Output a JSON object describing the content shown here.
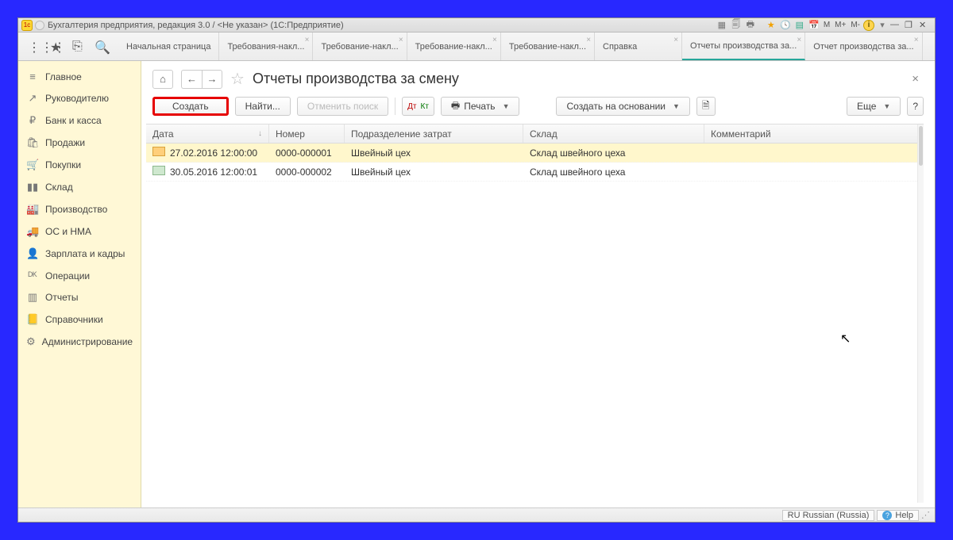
{
  "window": {
    "title": "Бухгалтерия предприятия, редакция 3.0 / <Не указан> (1С:Предприятие)"
  },
  "titlebar_btns": {
    "m": "M",
    "mplus": "M+",
    "mminus": "M-"
  },
  "tabs": {
    "start": "Начальная страница",
    "items": [
      {
        "label": "Требования-накл..."
      },
      {
        "label": "Требование-накл..."
      },
      {
        "label": "Требование-накл..."
      },
      {
        "label": "Требование-накл..."
      },
      {
        "label": "Справка"
      },
      {
        "label": "Отчеты производства за...",
        "active": true
      },
      {
        "label": "Отчет производства за..."
      }
    ]
  },
  "sidebar": [
    {
      "icon": "≡",
      "label": "Главное"
    },
    {
      "icon": "↗",
      "label": "Руководителю"
    },
    {
      "icon": "₽",
      "label": "Банк и касса"
    },
    {
      "icon": "🛍",
      "label": "Продажи"
    },
    {
      "icon": "🛒",
      "label": "Покупки"
    },
    {
      "icon": "▮▮",
      "label": "Склад"
    },
    {
      "icon": "🏭",
      "label": "Производство"
    },
    {
      "icon": "🚚",
      "label": "ОС и НМА"
    },
    {
      "icon": "👤",
      "label": "Зарплата и кадры"
    },
    {
      "icon": "ᴰᴷ",
      "label": "Операции"
    },
    {
      "icon": "▥",
      "label": "Отчеты"
    },
    {
      "icon": "📒",
      "label": "Справочники"
    },
    {
      "icon": "⚙",
      "label": "Администрирование"
    }
  ],
  "page": {
    "title": "Отчеты производства за смену"
  },
  "toolbar": {
    "create": "Создать",
    "find": "Найти...",
    "cancel": "Отменить поиск",
    "print": "Печать",
    "create_based": "Создать на основании",
    "more": "Еще",
    "help": "?"
  },
  "columns": {
    "date": "Дата",
    "number": "Номер",
    "subdiv": "Подразделение затрат",
    "warehouse": "Склад",
    "comment": "Комментарий"
  },
  "rows": [
    {
      "date": "27.02.2016 12:00:00",
      "number": "0000-000001",
      "subdiv": "Швейный цех",
      "warehouse": "Склад швейного цеха",
      "selected": true
    },
    {
      "date": "30.05.2016 12:00:01",
      "number": "0000-000002",
      "subdiv": "Швейный цех",
      "warehouse": "Склад швейного цеха",
      "selected": false
    }
  ],
  "status": {
    "lang": "RU Russian (Russia)",
    "help": "Help"
  }
}
